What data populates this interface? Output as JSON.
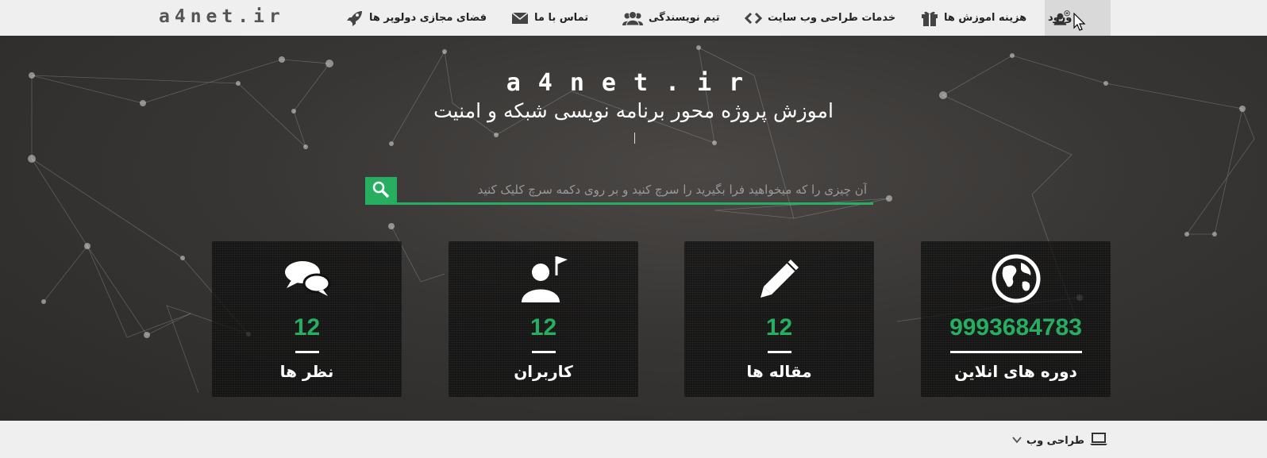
{
  "brand": "a4net.ir",
  "nav": {
    "login": "ورود",
    "course_costs": "هزینه اموزش ها",
    "web_design_services": "خدمات طراحی وب سایت",
    "writing_team": "تیم نویسندگی",
    "contact_us": "تماس با ما",
    "developer_space": "فضای مجازی دولوپر ها"
  },
  "hero": {
    "title": "a4net.ir",
    "subtitle": "اموزش پروژه محور برنامه نویسی شبکه و امنیت"
  },
  "search": {
    "placeholder": "آن چیزی را که میخواهید فرا بگیرید را سرچ کنید و بر روی دکمه سرچ کلیک کنید",
    "value": ""
  },
  "stats": [
    {
      "icon": "chat-bubbles-icon",
      "value": "12",
      "label": "نظر ها"
    },
    {
      "icon": "user-flag-icon",
      "value": "12",
      "label": "کاربران"
    },
    {
      "icon": "pencil-icon",
      "value": "12",
      "label": "مقاله ها"
    },
    {
      "icon": "globe-icon",
      "value": "9993684783",
      "label": "دوره های انلاین"
    }
  ],
  "bottom": {
    "category": "طراحی وب"
  },
  "colors": {
    "accent": "#27ae60",
    "topbar": "#efefef",
    "hero_bg": "#333333"
  }
}
